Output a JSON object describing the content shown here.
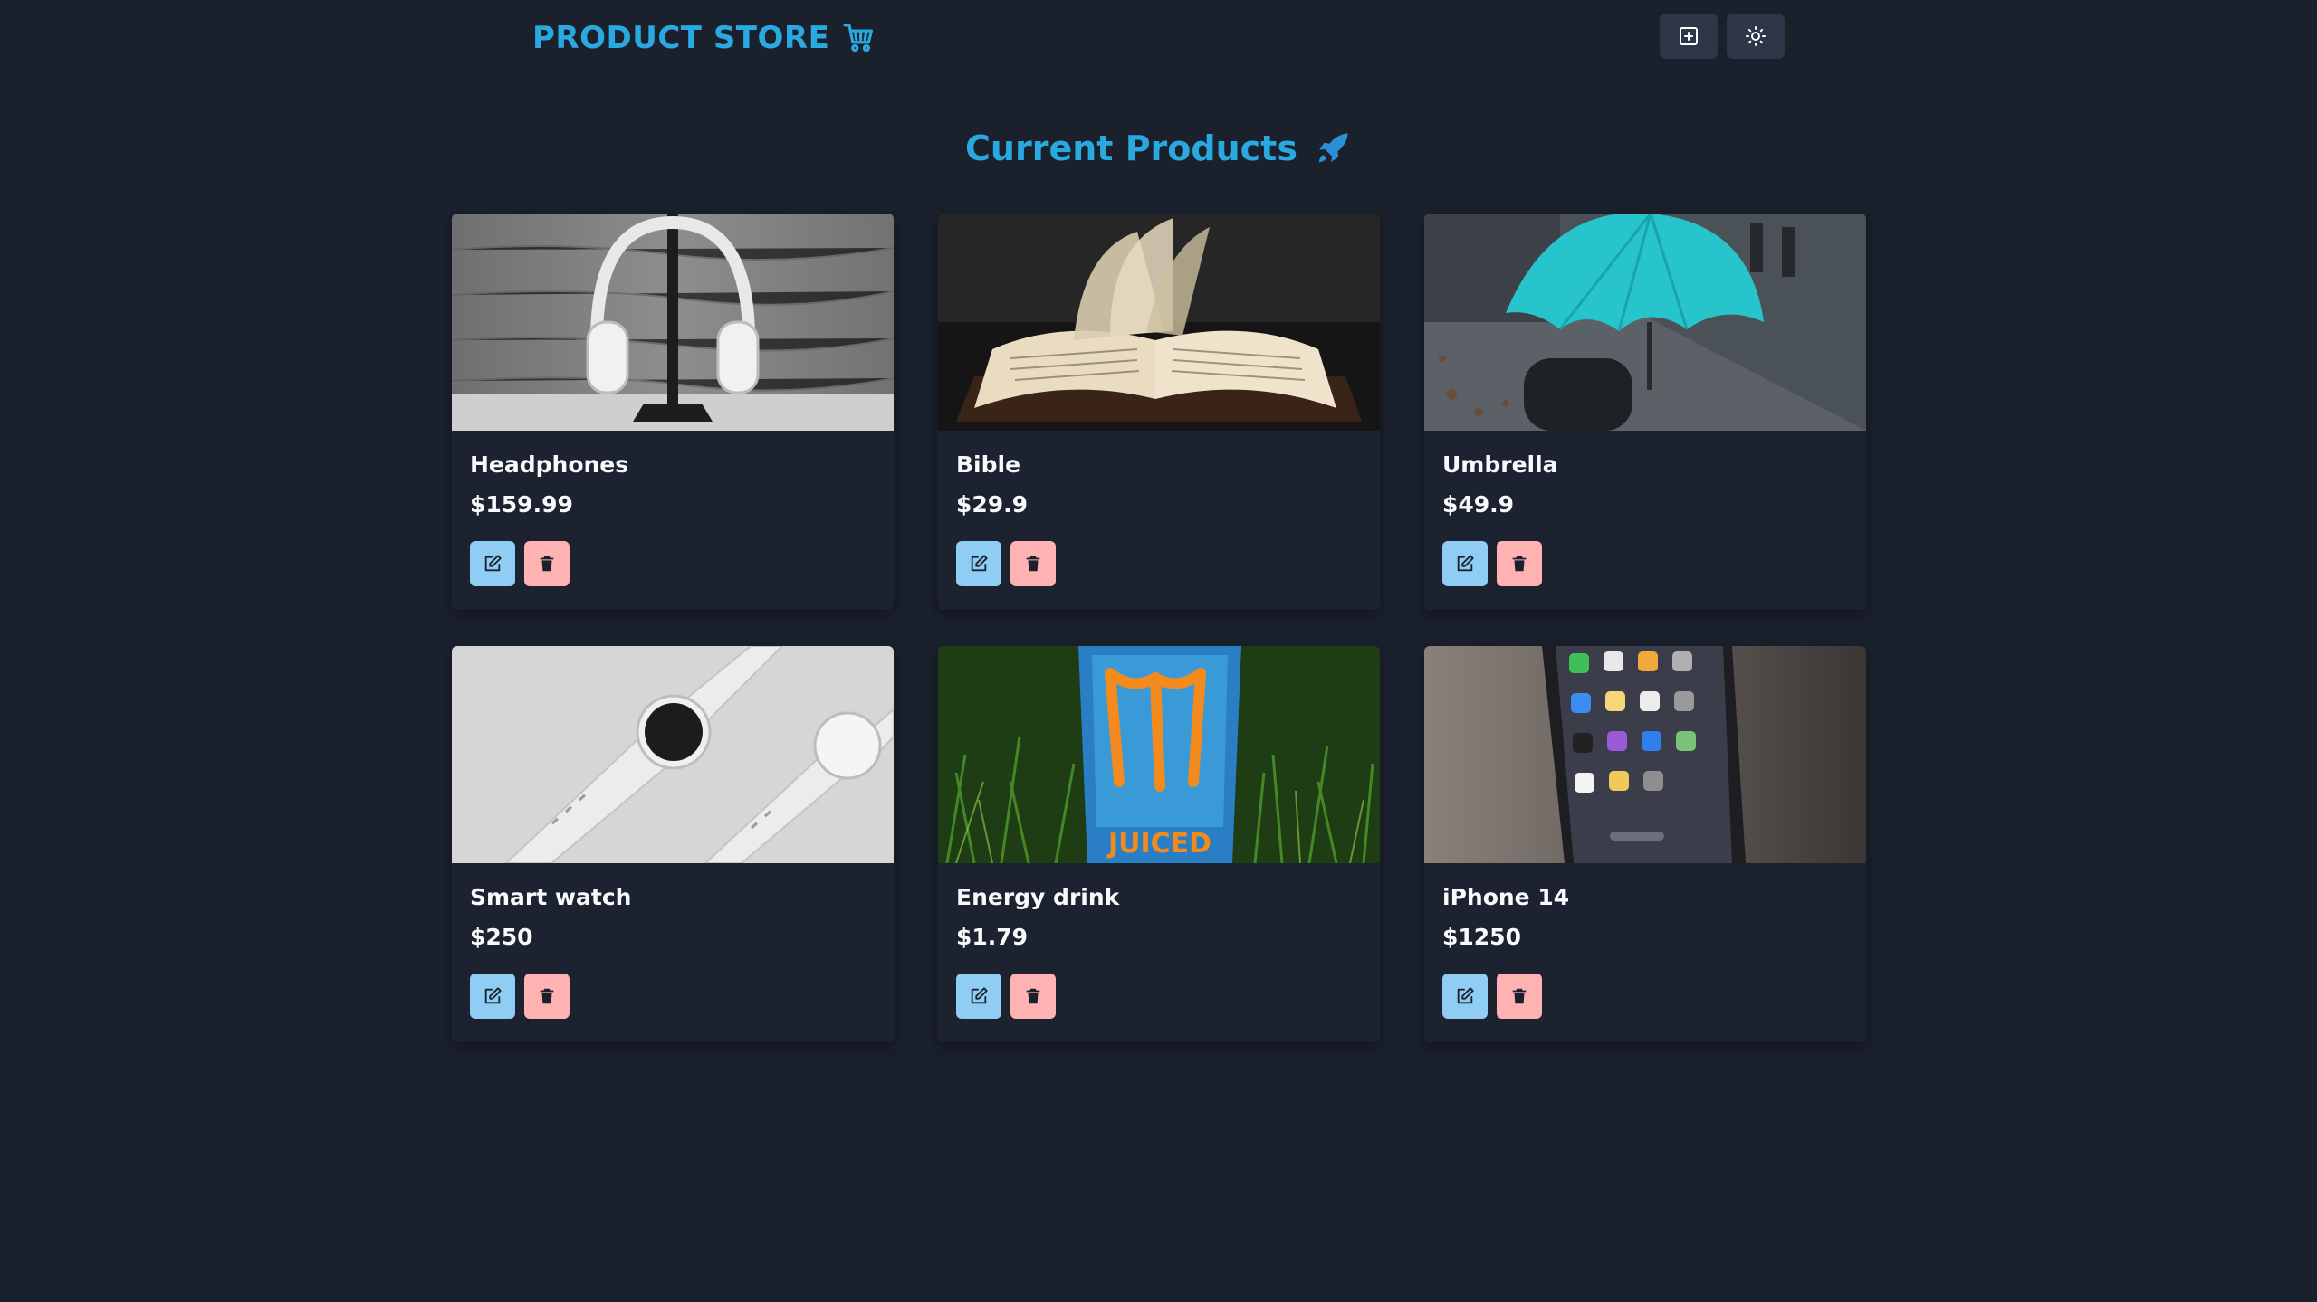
{
  "header": {
    "brand": "PRODUCT STORE",
    "brand_icon": "shopping-cart-icon",
    "create_icon": "plus-square-icon",
    "theme_icon": "sun-icon"
  },
  "main": {
    "heading": "Current Products",
    "heading_icon": "rocket-icon"
  },
  "products": [
    {
      "name": "Headphones",
      "price": "$159.99"
    },
    {
      "name": "Bible",
      "price": "$29.9"
    },
    {
      "name": "Umbrella",
      "price": "$49.9"
    },
    {
      "name": "Smart watch",
      "price": "$250"
    },
    {
      "name": "Energy drink",
      "price": "$1.79"
    },
    {
      "name": "iPhone 14",
      "price": "$1250"
    }
  ],
  "colors": {
    "background": "#1a202c",
    "accent": "#29a9e0",
    "edit_button": "#90cdf4",
    "delete_button": "#feb2b2"
  }
}
